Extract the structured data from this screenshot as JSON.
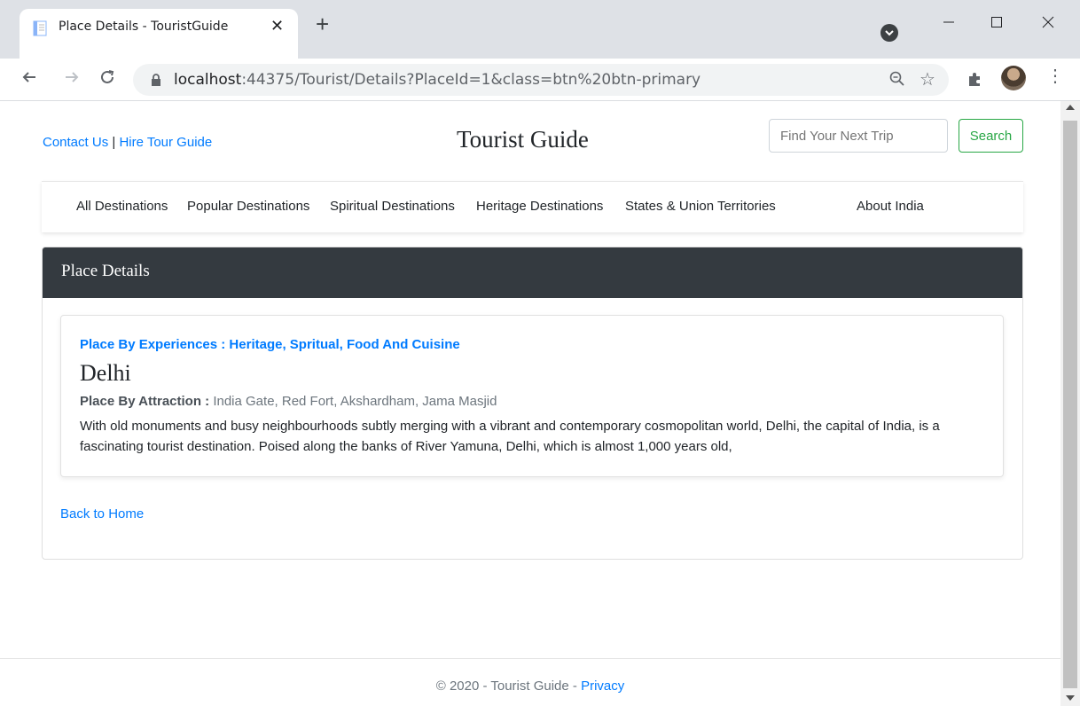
{
  "browser": {
    "tab_title": "Place Details - TouristGuide",
    "tab_close": "✕",
    "new_tab": "+",
    "url_host": "localhost",
    "url_path": ":44375/Tourist/Details?PlaceId=1&class=btn%20btn-primary"
  },
  "header": {
    "contact_us": "Contact Us",
    "separator": " | ",
    "hire_guide": "Hire Tour Guide",
    "site_title": "Tourist Guide",
    "search_placeholder": "Find Your Next Trip",
    "search_button": "Search"
  },
  "nav": {
    "items": [
      "All Destinations",
      "Popular Destinations",
      "Spiritual Destinations",
      "Heritage Destinations",
      "States & Union Territories",
      "About India"
    ]
  },
  "card": {
    "header_title": "Place Details",
    "experiences": "Place By Experiences : Heritage, Spritual, Food And Cuisine",
    "place_name": "Delhi",
    "attraction_label": "Place By Attraction :",
    "attraction_value": " India Gate, Red Fort, Akshardham, Jama Masjid",
    "description": "With old monuments and busy neighbourhoods subtly merging with a vibrant and contemporary cosmopolitan world, Delhi, the capital of India, is a fascinating tourist destination. Poised along the banks of River Yamuna, Delhi, which is almost 1,000 years old,",
    "back_link": "Back to Home"
  },
  "footer": {
    "copyright": "© 2020 - Tourist Guide - ",
    "privacy": "Privacy"
  }
}
